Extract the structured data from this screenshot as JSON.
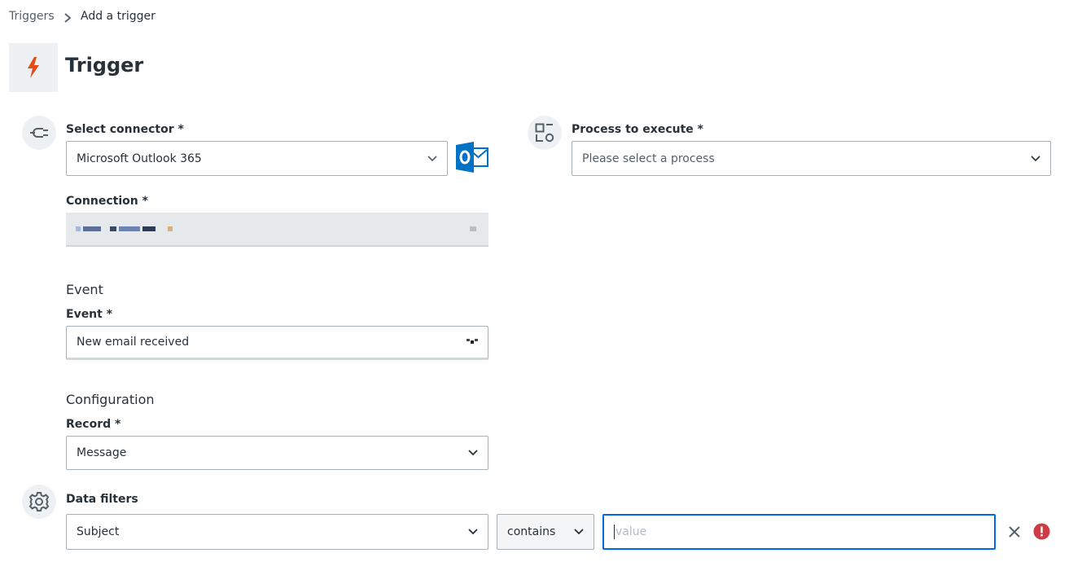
{
  "breadcrumb": {
    "parent": "Triggers",
    "current": "Add a trigger"
  },
  "page": {
    "title": "Trigger"
  },
  "connector": {
    "label": "Select connector *",
    "value": "Microsoft Outlook 365"
  },
  "process": {
    "label": "Process to execute *",
    "placeholder": "Please select a process"
  },
  "connection": {
    "label": "Connection *"
  },
  "event": {
    "heading": "Event",
    "label": "Event *",
    "value": "New email received"
  },
  "configuration": {
    "heading": "Configuration",
    "record_label": "Record *",
    "record_value": "Message"
  },
  "filters": {
    "label": "Data filters",
    "field_value": "Subject",
    "operator_value": "contains",
    "value_placeholder": "value"
  },
  "colors": {
    "accent": "#0067df",
    "trigger_icon": "#e64a19",
    "outlook": "#0072c6",
    "error": "#cc3d45"
  }
}
